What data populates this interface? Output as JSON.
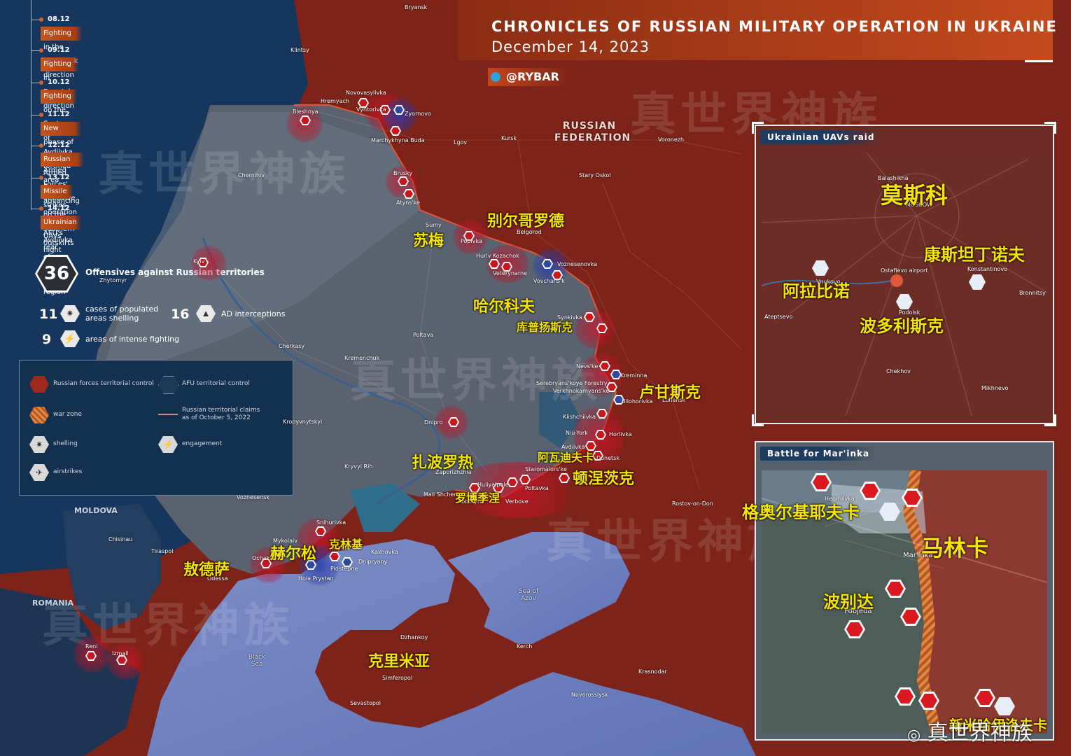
{
  "title": "CHRONICLES OF RUSSIAN MILITARY OPERATION IN UKRAINE",
  "date": "December 14, 2023",
  "brand": "@RYBAR",
  "watermark": "真世界神族",
  "timeline": [
    {
      "date": "08.12",
      "text": "Fighting in the Starobilsk direction"
    },
    {
      "date": "09.12",
      "text": "Fighting in Donetsk direction"
    },
    {
      "date": "10.12",
      "text": "Fighting on the flanks of Avdiivka fortified area"
    },
    {
      "date": "11.12",
      "text": "New phase of Russian Armed Forces' offensive operation near Avdiivka"
    },
    {
      "date": "12.12",
      "text": "Russian Armed Forces advancing on the southern outskirts of Avdiivka"
    },
    {
      "date": "13.12",
      "text": "Missile strikes on AFU's rear objects"
    },
    {
      "date": "14.12",
      "text": "Ukrainian UAVs night raid on Moscow region"
    }
  ],
  "stats": {
    "offensives": "36",
    "offensives_label": "Offensives against Russian territories",
    "shelling": "11",
    "shelling_label": "cases of populated areas shelling",
    "ad": "16",
    "ad_label": "AD interceptions",
    "fighting": "9",
    "fighting_label": "areas of intense fighting"
  },
  "legend": [
    "Russian forces territorial control",
    "AFU territorial control",
    "war zone",
    "Russian territorial claims as of October 5, 2022",
    "shelling",
    "engagement",
    "airstrikes"
  ],
  "icons": {
    "shelling": "explosion-icon",
    "engagement": "lightning-icon",
    "airstrikes": "airstrike-icon",
    "ad": "ad-vehicle-icon"
  },
  "colors": {
    "russian_control": "#7d2319",
    "afu_control": "#5a6270",
    "war_zone": "#e08a3c",
    "marker": "#c8161d",
    "ad_marker": "#2d4aa0",
    "annotation": "#f5e300"
  },
  "cities": [
    "Bryansk",
    "Klintsy",
    "Novovasylivka",
    "Hremyach",
    "Vyntorivka",
    "Zyornovo",
    "Bleshnya",
    "Marchykhyna Buda",
    "Lgov",
    "Kursk",
    "Voronezh",
    "Brusky",
    "Atyns'ke",
    "Stary Oskol",
    "Chernihiv",
    "Sumy",
    "Belgorod",
    "Popivka",
    "Huriv Kozachok",
    "Veterynarne",
    "Voznesenovka",
    "Vovchans'k",
    "Kyiv",
    "Zhytomyr",
    "Synkivka",
    "Poltava",
    "Cherkasy",
    "Kremenchuk",
    "Nevs'ke",
    "Kreminna",
    "Serebryans'koye Forestry",
    "Verkhnokamyans'ke",
    "Bilohorivka",
    "Luhansk",
    "Klishchiivka",
    "Kropyvnytskyi",
    "Dnipro",
    "Niu-York",
    "Horlivka",
    "Avdiivka",
    "Donetsk",
    "Kryvyi Rih",
    "Zaporizhzhia",
    "Staromaiors'ke",
    "Huliyaipole",
    "Poltavka",
    "Mali Shcherbaky",
    "Robotyne",
    "Verbove",
    "Voznesensk",
    "Rostov-on-Don",
    "MOLDOVA",
    "Snihurivka",
    "Chisinau",
    "Mykolaiv",
    "Krynky",
    "Kakhovka",
    "Tiraspol",
    "Ochakiv",
    "Dnipryany",
    "Pidstepne",
    "Odessa",
    "Hola Prystan",
    "ROMANIA",
    "Dzhankoy",
    "Kerch",
    "Reni",
    "Izmail",
    "Krasnodar",
    "Simferopol",
    "Novorossiysk",
    "Sevastopol",
    "Black Sea",
    "Sea of Azov",
    "RUSSIAN FEDERATION"
  ],
  "cn": [
    "别尔哥罗德",
    "苏梅",
    "哈尔科夫",
    "库普扬斯克",
    "卢甘斯克",
    "扎波罗热",
    "阿瓦迪夫卡",
    "顿涅茨克",
    "罗博季涅",
    "克林基",
    "赫尔松",
    "敖德萨",
    "克里米亚"
  ],
  "inset_uav": {
    "title": "Ukrainian UAVs raid",
    "places": [
      "Balashikha",
      "MOSCOW",
      "Vnukovo",
      "Ostafievo airport",
      "Konstantinovo",
      "Bronnitsy",
      "Podolsk",
      "Ateptsevo",
      "Chekhov",
      "Mikhnevo"
    ],
    "cn": [
      "莫斯科",
      "康斯坦丁诺夫",
      "阿拉比诺",
      "波多利斯克"
    ]
  },
  "inset_marinka": {
    "title": "Battle for Mar'inka",
    "places": [
      "Heorhiivka",
      "Mar'inka",
      "Pobjeda"
    ],
    "cn": [
      "格奥尔基耶夫卡",
      "马林卡",
      "波别达",
      "新米哈伊洛夫卡"
    ]
  }
}
